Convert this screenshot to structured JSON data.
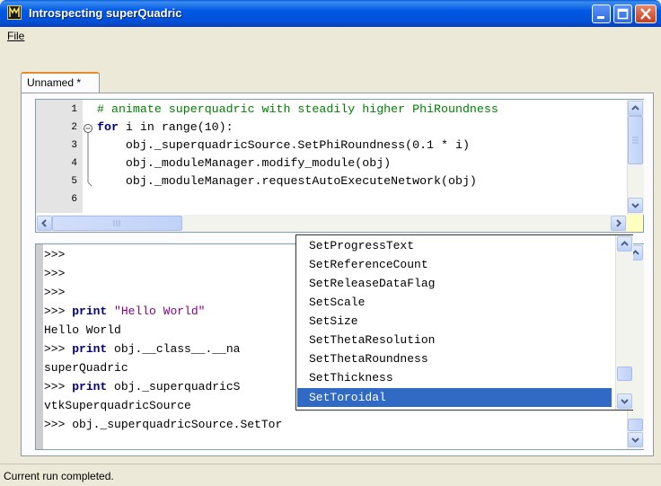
{
  "window": {
    "title": "Introspecting superQuadric"
  },
  "menu": {
    "file_label": "File"
  },
  "editor": {
    "tab_label": "Unnamed *",
    "line_numbers": [
      "1",
      "2",
      "3",
      "4",
      "5",
      "6"
    ],
    "lines": [
      "# animate superquadric with steadily higher PhiRoundness",
      "for i in range(10):",
      "    obj._superquadricSource.SetPhiRoundness(0.1 * i)",
      "    obj._moduleManager.modify_module(obj)",
      "    obj._moduleManager.requestAutoExecuteNetwork(obj)",
      ""
    ],
    "for_keyword": "for",
    "for_rest": " i in range(10):"
  },
  "console": {
    "lines": [
      {
        "prompt": ">>>",
        "kw": "",
        "text": "",
        "str": ""
      },
      {
        "prompt": ">>>",
        "kw": "",
        "text": "",
        "str": ""
      },
      {
        "prompt": ">>>",
        "kw": "",
        "text": "",
        "str": ""
      },
      {
        "prompt": ">>> ",
        "kw": "print",
        "text": " ",
        "str": "\"Hello World\""
      },
      {
        "prompt": "",
        "kw": "",
        "text": "Hello World",
        "str": ""
      },
      {
        "prompt": ">>> ",
        "kw": "print",
        "text": " obj.__class__.__na",
        "str": ""
      },
      {
        "prompt": "",
        "kw": "",
        "text": "superQuadric",
        "str": ""
      },
      {
        "prompt": ">>> ",
        "kw": "print",
        "text": " obj._superquadricS",
        "str": ""
      },
      {
        "prompt": "",
        "kw": "",
        "text": "vtkSuperquadricSource",
        "str": ""
      },
      {
        "prompt": ">>> ",
        "kw": "",
        "text": "obj._superquadricSource.SetTor",
        "str": ""
      }
    ]
  },
  "autocomplete": {
    "items": [
      "SetProgressText",
      "SetReferenceCount",
      "SetReleaseDataFlag",
      "SetScale",
      "SetSize",
      "SetThetaResolution",
      "SetThetaRoundness",
      "SetThickness",
      "SetToroidal"
    ],
    "selected_index": 8
  },
  "status": {
    "text": "Current run completed."
  },
  "colors": {
    "selection": "#316ac5",
    "comment": "#008000",
    "keyword": "#000080",
    "string": "#7f007f"
  }
}
